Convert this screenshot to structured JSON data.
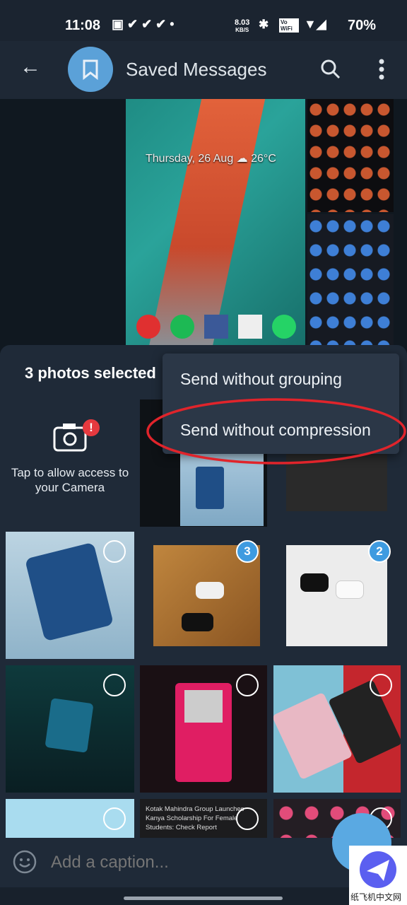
{
  "status_bar": {
    "time": "11:08",
    "net_speed": "8.03",
    "net_unit": "KB/S",
    "vowifi": "Vo WiFi",
    "battery": "70%"
  },
  "header": {
    "title": "Saved Messages",
    "icons": [
      "back-arrow-icon",
      "bookmark-icon",
      "search-icon",
      "more-vert-icon"
    ]
  },
  "chat": {
    "wallpaper_text": "Thursday, 26 Aug ☁ 26°C"
  },
  "sheet": {
    "selected_label": "3 photos selected",
    "camera_text": "Tap to allow access to your Camera"
  },
  "menu": {
    "items": [
      "Send without grouping",
      "Send without compression"
    ]
  },
  "grid": {
    "badges": [
      "3",
      "2"
    ],
    "news_text": "Kotak Mahindra Group Launches Kanya Scholarship For Female Students: Check Report"
  },
  "caption": {
    "placeholder": "Add a caption..."
  },
  "watermark": "纸飞机中文网",
  "colors": {
    "accent": "#3e9be0",
    "annotation": "#e0242b",
    "menu_bg": "#2b3747",
    "sheet_bg": "#1f2a38"
  }
}
